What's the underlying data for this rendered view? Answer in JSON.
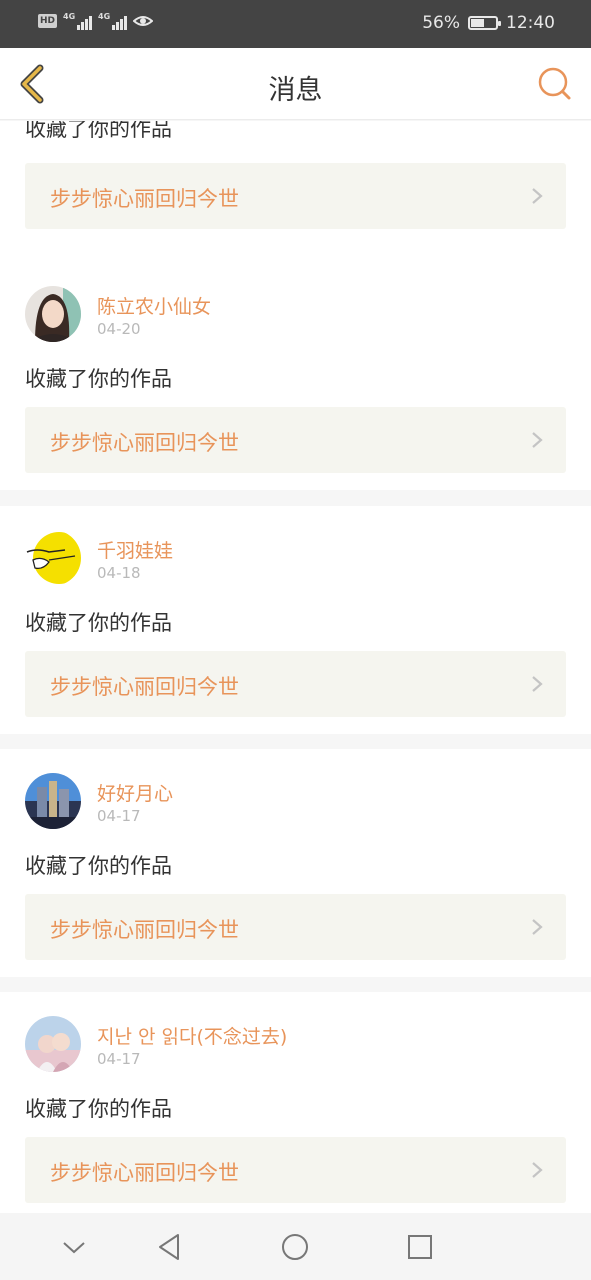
{
  "status_bar": {
    "hd": "HD",
    "network_1": "4G",
    "network_2": "4G",
    "battery": "56%",
    "battery_level": 0.56,
    "time": "12:40"
  },
  "header": {
    "title": "消息"
  },
  "partial_item": {
    "action": "收藏了你的作品",
    "work_title": "步步惊心丽回归今世"
  },
  "messages": [
    {
      "user": "陈立农小仙女",
      "date": "04-20",
      "action": "收藏了你的作品",
      "work_title": "步步惊心丽回归今世"
    },
    {
      "user": "千羽娃娃",
      "date": "04-18",
      "action": "收藏了你的作品",
      "work_title": "步步惊心丽回归今世"
    },
    {
      "user": "好好月心",
      "date": "04-17",
      "action": "收藏了你的作品",
      "work_title": "步步惊心丽回归今世"
    },
    {
      "user": "지난 안 읽다(不念过去)",
      "date": "04-17",
      "action": "收藏了你的作品",
      "work_title": "步步惊心丽回归今世"
    }
  ],
  "colors": {
    "accent": "#e8945a",
    "back_arrow": "#e6b84a",
    "status_bar": "#444444",
    "card_bg": "#f5f5ef"
  },
  "icons": {
    "back": "back-arrow-icon",
    "search": "search-icon",
    "chevron": "chevron-right-icon",
    "nav_hide": "chevron-down-icon",
    "nav_back": "triangle-back-icon",
    "nav_home": "circle-home-icon",
    "nav_recent": "square-recent-icon"
  }
}
